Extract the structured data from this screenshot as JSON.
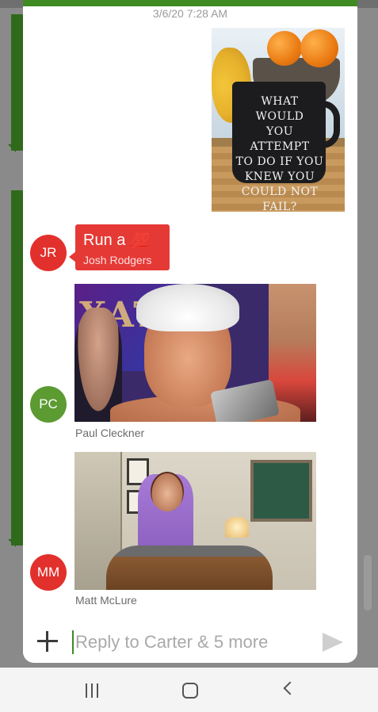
{
  "conversation": {
    "timestamp": "3/6/20 7:28 AM",
    "mug_text": "WHAT WOULD\nYOU ATTEMPT\nTO DO IF YOU\nKNEW YOU\nCOULD NOT FAIL?"
  },
  "messages": [
    {
      "initials": "JR",
      "text": "Run a",
      "emoji": "💯",
      "sender": "Josh Rodgers",
      "avatar_color": "#e2302c"
    },
    {
      "initials": "PC",
      "sender": "Paul Cleckner",
      "avatar_color": "#5c9a32",
      "banner_text": "XAT"
    },
    {
      "initials": "MM",
      "sender": "Matt McLure",
      "avatar_color": "#e2302c"
    }
  ],
  "composer": {
    "placeholder": "Reply to Carter & 5 more"
  },
  "colors": {
    "accent": "#3f8a22",
    "bubble_red": "#e53935"
  },
  "icons": {
    "attach": "plus-icon",
    "send": "send-icon",
    "nav_recents": "recents-icon",
    "nav_home": "home-icon",
    "nav_back": "back-icon"
  }
}
